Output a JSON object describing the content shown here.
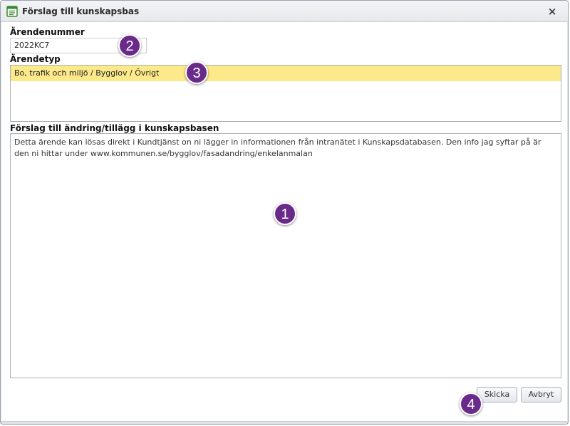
{
  "window": {
    "title": "Förslag till kunskapsbas",
    "close_label": "×"
  },
  "form": {
    "case_number_label": "Ärendenummer",
    "case_number_value": "2022KC7",
    "case_type_label": "Ärendetyp",
    "case_type_selected": "Bo, trafik och miljö / Bygglov / Övrigt",
    "suggestion_label": "Förslag till ändring/tillägg i kunskapsbasen",
    "suggestion_text": "Detta ärende kan lösas direkt i Kundtjänst on ni lägger in informationen från intranätet i Kunskapsdatabasen. Den info jag syftar på är den ni hittar under www.kommunen.se/bygglov/fasadandring/enkelanmalan"
  },
  "buttons": {
    "send_label": "Skicka",
    "cancel_label": "Avbryt"
  },
  "annotations": {
    "badge_1": "1",
    "badge_2": "2",
    "badge_3": "3",
    "badge_4": "4"
  },
  "colors": {
    "selection_highlight": "#fbe98a",
    "badge_fill": "#6a2a8a",
    "icon_green": "#3a8a2e"
  },
  "icons": {
    "title": "form-document-icon",
    "close": "close-icon"
  }
}
